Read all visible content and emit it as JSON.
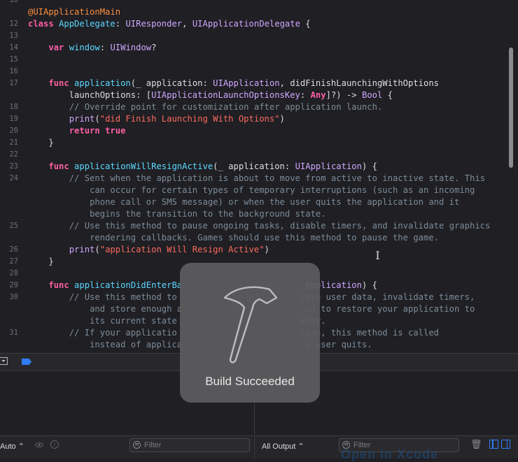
{
  "editor": {
    "lines": [
      {
        "num": "10",
        "segs": [
          {
            "t": "",
            "c": ""
          }
        ]
      },
      {
        "num": "",
        "segs": [
          {
            "t": "@UIApplicationMain",
            "c": "an"
          }
        ]
      },
      {
        "num": "12",
        "segs": [
          {
            "t": "class ",
            "c": "kw"
          },
          {
            "t": "AppDelegate",
            "c": "dc"
          },
          {
            "t": ": ",
            "c": ""
          },
          {
            "t": "UIResponder",
            "c": "ty"
          },
          {
            "t": ", ",
            "c": ""
          },
          {
            "t": "UIApplicationDelegate",
            "c": "ty"
          },
          {
            "t": " {",
            "c": ""
          }
        ]
      },
      {
        "num": "13",
        "segs": [
          {
            "t": "",
            "c": ""
          }
        ]
      },
      {
        "num": "14",
        "segs": [
          {
            "t": "    ",
            "c": ""
          },
          {
            "t": "var ",
            "c": "kw"
          },
          {
            "t": "window",
            "c": "dc"
          },
          {
            "t": ": ",
            "c": ""
          },
          {
            "t": "UIWindow",
            "c": "ty"
          },
          {
            "t": "?",
            "c": ""
          }
        ]
      },
      {
        "num": "15",
        "segs": [
          {
            "t": "",
            "c": ""
          }
        ]
      },
      {
        "num": "16",
        "segs": [
          {
            "t": "",
            "c": ""
          }
        ]
      },
      {
        "num": "17",
        "segs": [
          {
            "t": "    ",
            "c": ""
          },
          {
            "t": "func ",
            "c": "kw"
          },
          {
            "t": "application",
            "c": "dc"
          },
          {
            "t": "(_ application: ",
            "c": ""
          },
          {
            "t": "UIApplication",
            "c": "ty"
          },
          {
            "t": ", didFinishLaunchingWithOptions",
            "c": ""
          }
        ]
      },
      {
        "num": "",
        "segs": [
          {
            "t": "        launchOptions: [",
            "c": ""
          },
          {
            "t": "UIApplicationLaunchOptionsKey",
            "c": "ty"
          },
          {
            "t": ": ",
            "c": ""
          },
          {
            "t": "Any",
            "c": "kw"
          },
          {
            "t": "]?) -> ",
            "c": ""
          },
          {
            "t": "Bool",
            "c": "ty"
          },
          {
            "t": " {",
            "c": ""
          }
        ]
      },
      {
        "num": "18",
        "segs": [
          {
            "t": "        ",
            "c": ""
          },
          {
            "t": "// Override point for customization after application launch.",
            "c": "cm"
          }
        ]
      },
      {
        "num": "19",
        "segs": [
          {
            "t": "        ",
            "c": ""
          },
          {
            "t": "print",
            "c": "ty"
          },
          {
            "t": "(",
            "c": ""
          },
          {
            "t": "\"did Finish Launching With Options\"",
            "c": "st"
          },
          {
            "t": ")",
            "c": ""
          }
        ]
      },
      {
        "num": "20",
        "segs": [
          {
            "t": "        ",
            "c": ""
          },
          {
            "t": "return true",
            "c": "kw"
          }
        ]
      },
      {
        "num": "21",
        "segs": [
          {
            "t": "    }",
            "c": ""
          }
        ]
      },
      {
        "num": "22",
        "segs": [
          {
            "t": "",
            "c": ""
          }
        ]
      },
      {
        "num": "23",
        "segs": [
          {
            "t": "    ",
            "c": ""
          },
          {
            "t": "func ",
            "c": "kw"
          },
          {
            "t": "applicationWillResignActive",
            "c": "dc"
          },
          {
            "t": "(_ application: ",
            "c": ""
          },
          {
            "t": "UIApplication",
            "c": "ty"
          },
          {
            "t": ") {",
            "c": ""
          }
        ]
      },
      {
        "num": "24",
        "segs": [
          {
            "t": "        ",
            "c": ""
          },
          {
            "t": "// Sent when the application is about to move from active to inactive state. This",
            "c": "cm"
          }
        ]
      },
      {
        "num": "",
        "segs": [
          {
            "t": "            ",
            "c": ""
          },
          {
            "t": "can occur for certain types of temporary interruptions (such as an incoming",
            "c": "cm"
          }
        ]
      },
      {
        "num": "",
        "segs": [
          {
            "t": "            ",
            "c": ""
          },
          {
            "t": "phone call or SMS message) or when the user quits the application and it",
            "c": "cm"
          }
        ]
      },
      {
        "num": "",
        "segs": [
          {
            "t": "            ",
            "c": ""
          },
          {
            "t": "begins the transition to the background state.",
            "c": "cm"
          }
        ]
      },
      {
        "num": "25",
        "segs": [
          {
            "t": "        ",
            "c": ""
          },
          {
            "t": "// Use this method to pause ongoing tasks, disable timers, and invalidate graphics",
            "c": "cm"
          }
        ]
      },
      {
        "num": "",
        "segs": [
          {
            "t": "            ",
            "c": ""
          },
          {
            "t": "rendering callbacks. Games should use this method to pause the game.",
            "c": "cm"
          }
        ]
      },
      {
        "num": "26",
        "segs": [
          {
            "t": "        ",
            "c": ""
          },
          {
            "t": "print",
            "c": "ty"
          },
          {
            "t": "(",
            "c": ""
          },
          {
            "t": "\"application Will Resign Active\"",
            "c": "st"
          },
          {
            "t": ")",
            "c": ""
          }
        ]
      },
      {
        "num": "27",
        "segs": [
          {
            "t": "    }",
            "c": ""
          }
        ]
      },
      {
        "num": "28",
        "segs": [
          {
            "t": "",
            "c": ""
          }
        ]
      },
      {
        "num": "29",
        "segs": [
          {
            "t": "    ",
            "c": ""
          },
          {
            "t": "func ",
            "c": "kw"
          },
          {
            "t": "applicationDidEnterBa",
            "c": "dc"
          },
          {
            "t": "                        ",
            "c": ""
          },
          {
            "t": "Application",
            "c": "ty"
          },
          {
            "t": ") {",
            "c": ""
          }
        ]
      },
      {
        "num": "30",
        "segs": [
          {
            "t": "        ",
            "c": ""
          },
          {
            "t": "// Use this method to                        save user data, invalidate timers,",
            "c": "cm"
          }
        ]
      },
      {
        "num": "",
        "segs": [
          {
            "t": "            ",
            "c": ""
          },
          {
            "t": "and store enough a                        on to restore your application to",
            "c": "cm"
          }
        ]
      },
      {
        "num": "",
        "segs": [
          {
            "t": "            ",
            "c": ""
          },
          {
            "t": "its current state                        ater.",
            "c": "cm"
          }
        ]
      },
      {
        "num": "31",
        "segs": [
          {
            "t": "        ",
            "c": ""
          },
          {
            "t": "// If your applicatio                        tion, this method is called",
            "c": "cm"
          }
        ]
      },
      {
        "num": "",
        "segs": [
          {
            "t": "            ",
            "c": ""
          },
          {
            "t": "instead of applica                        e user quits.",
            "c": "cm"
          }
        ]
      }
    ]
  },
  "variables_pane": {
    "scope_label": "Auto",
    "filter_placeholder": "Filter"
  },
  "console_pane": {
    "output_label": "All Output",
    "filter_placeholder": "Filter"
  },
  "hud": {
    "message": "Build Succeeded",
    "icon": "hammer-icon"
  },
  "background_peek": "Open in Xcode",
  "colors": {
    "background": "#1f1f24",
    "keyword": "#fc5fa3",
    "type": "#d0a8ff",
    "declaration": "#5dd8ff",
    "string": "#fc6a5d",
    "comment": "#7f8c98",
    "attribute": "#fd8f3f",
    "accent": "#2f7cf6"
  }
}
